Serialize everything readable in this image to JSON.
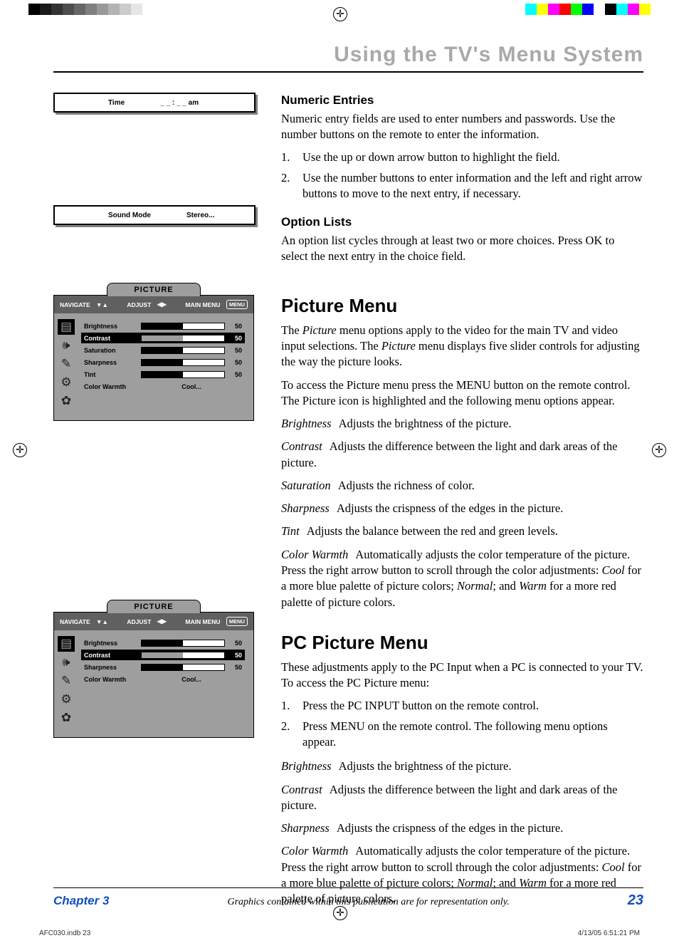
{
  "page_title": "Using the TV's Menu System",
  "minibox_time": {
    "label": "Time",
    "value": "_ _ : _ _ am"
  },
  "minibox_sound": {
    "label": "Sound Mode",
    "value": "Stereo..."
  },
  "numeric": {
    "heading": "Numeric Entries",
    "intro": "Numeric entry fields are used to enter numbers and passwords. Use the number buttons on the remote to enter the information.",
    "step1_num": "1.",
    "step1": "Use the up or down arrow button to highlight the field.",
    "step2_num": "2.",
    "step2": "Use the number buttons to enter information and the left and right arrow buttons to move to the next entry, if necessary."
  },
  "option": {
    "heading": "Option Lists",
    "body": "An option list cycles through at least two or more choices. Press OK to select the next entry in the choice field."
  },
  "picture_menu_box": {
    "tab": "PICTURE",
    "nav": "NAVIGATE",
    "nav_sym": "▼▲",
    "adj": "ADJUST",
    "adj_sym": "◀▶",
    "main": "MAIN MENU",
    "main_btn": "MENU",
    "rows": [
      {
        "label": "Brightness",
        "value": "50"
      },
      {
        "label": "Contrast",
        "value": "50"
      },
      {
        "label": "Saturation",
        "value": "50"
      },
      {
        "label": "Sharpness",
        "value": "50"
      },
      {
        "label": "Tint",
        "value": "50"
      },
      {
        "label": "Color Warmth",
        "text": "Cool..."
      }
    ]
  },
  "pc_menu_box": {
    "tab": "PICTURE",
    "rows": [
      {
        "label": "Brightness",
        "value": "50"
      },
      {
        "label": "Contrast",
        "value": "50"
      },
      {
        "label": "Sharpness",
        "value": "50"
      },
      {
        "label": "Color Warmth",
        "text": "Cool..."
      }
    ]
  },
  "picture": {
    "heading": "Picture Menu",
    "p1a": "The ",
    "p1b": "Picture",
    "p1c": " menu options apply to the video for the main TV and video input selections. The ",
    "p1d": "Picture",
    "p1e": " menu displays five slider controls for adjusting the way the picture looks.",
    "p2": "To access the Picture menu press the MENU button on the remote control. The Picture icon is highlighted and the following menu options appear.",
    "d1t": "Brightness",
    "d1": "Adjusts the brightness of the picture.",
    "d2t": "Contrast",
    "d2": "Adjusts the difference between the light and dark areas of the picture.",
    "d3t": "Saturation",
    "d3": "Adjusts the richness of color.",
    "d4t": "Sharpness",
    "d4": "Adjusts the crispness of the edges in the picture.",
    "d5t": "Tint",
    "d5": "Adjusts the balance between the red and green levels.",
    "d6t": "Color Warmth",
    "d6a": "Automatically adjusts the color temperature of the picture. Press the right arrow button to scroll through the color adjustments: ",
    "d6b": "Cool",
    "d6c": " for a more blue palette of picture colors; ",
    "d6d": "Normal",
    "d6e": "; and ",
    "d6f": "Warm",
    "d6g": " for a more red palette of picture colors."
  },
  "pcpicture": {
    "heading": "PC Picture Menu",
    "p1": "These adjustments apply to the PC Input when a PC is connected to your TV. To access the PC Picture menu:",
    "s1n": "1.",
    "s1": "Press the PC INPUT button on the remote control.",
    "s2n": "2.",
    "s2": "Press MENU on the remote control. The following menu options appear.",
    "d1t": "Brightness",
    "d1": "Adjusts the brightness of the picture.",
    "d2t": "Contrast",
    "d2": "Adjusts the difference between the light and dark areas of the picture.",
    "d3t": "Sharpness",
    "d3": "Adjusts the crispness of the edges in the picture.",
    "d4t": "Color Warmth",
    "d4a": "Automatically adjusts the color temperature of the picture. Press the right arrow button to scroll through the color adjustments: ",
    "d4b": "Cool",
    "d4c": " for a more blue palette of picture colors; ",
    "d4d": "Normal",
    "d4e": "; and ",
    "d4f": "Warm",
    "d4g": " for a more red palette of picture colors."
  },
  "footer": {
    "chapter": "Chapter 3",
    "disclaimer": "Graphics contained within this publication are for representation only.",
    "page": "23"
  },
  "print": {
    "file": "AFC030.indb   23",
    "date": "4/13/05   6:51:21 PM"
  },
  "colors_left": [
    "#000",
    "#1a1a1a",
    "#333",
    "#4d4d4d",
    "#666",
    "#808080",
    "#999",
    "#b3b3b3",
    "#ccc",
    "#e6e6e6",
    "#fff"
  ],
  "colors_right": [
    "#0ff",
    "#ff0",
    "#f0f",
    "#f00",
    "#0f0",
    "#00f",
    "#fff",
    "#000",
    "#0ff",
    "#f0f",
    "#ff0"
  ]
}
